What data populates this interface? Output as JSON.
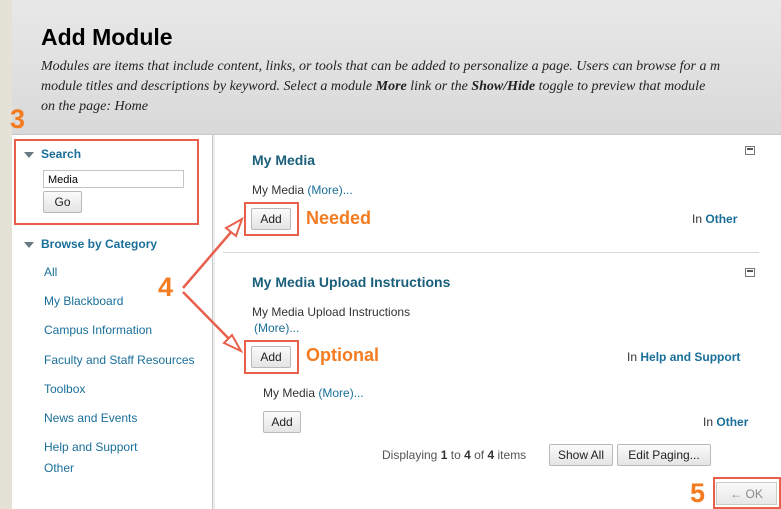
{
  "header": {
    "title": "Add Module",
    "desc": {
      "p1": "Modules are items that include content, links, or tools that can be added to personalize a page. Users can browse for a m",
      "p2a": "module titles and descriptions by keyword. Select a module ",
      "p2_more": "More",
      "p2b": " link or the ",
      "p2_toggle": "Show/Hide",
      "p2c": " toggle to preview that module",
      "p3": "on the page: Home"
    }
  },
  "sidebar": {
    "search_title": "Search",
    "search_value": "Media",
    "go_label": "Go",
    "browse_title": "Browse by Category",
    "categories": [
      "All",
      "My Blackboard",
      "Campus Information",
      "Faculty and Staff Resources",
      "Toolbox",
      "News and Events",
      "Help and Support",
      "Other"
    ]
  },
  "modules": [
    {
      "title": "My Media",
      "desc": "My Media",
      "more": "(More)...",
      "add": "Add",
      "in": "In",
      "category": "Other"
    },
    {
      "title": "My Media Upload Instructions",
      "desc": "My Media Upload Instructions",
      "more": "(More)...",
      "add": "Add",
      "in": "In",
      "category": "Help and Support"
    },
    {
      "desc": "My Media",
      "more": "(More)...",
      "add": "Add",
      "in": "In",
      "category": "Other"
    }
  ],
  "paging": {
    "displaying": "Displaying",
    "from": "1",
    "to_word": "to",
    "to": "4",
    "of_word": "of",
    "total": "4",
    "items": "items",
    "show_all": "Show All",
    "edit_paging": "Edit Paging..."
  },
  "ok_label": "← OK",
  "annotations": {
    "step3": "3",
    "step4": "4",
    "step5": "5",
    "needed": "Needed",
    "optional": "Optional",
    "accent_color": "#f47b20",
    "box_color": "#e8604c"
  }
}
